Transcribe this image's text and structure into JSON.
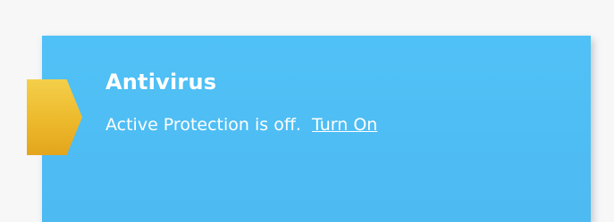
{
  "antivirus": {
    "title": "Antivirus",
    "status_text": "Active Protection is off.",
    "turn_on_link": "Turn On"
  },
  "colors": {
    "page_background": "#f7f7f8",
    "card_background": "#50c1f6",
    "badge_accent": "#edb92c",
    "text": "#ffffff"
  },
  "icons": {
    "status_badge": "warning-flag-icon"
  }
}
